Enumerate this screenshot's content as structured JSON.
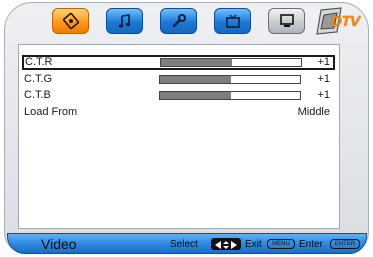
{
  "tabs": [
    {
      "id": "picture",
      "icon": "picture-icon",
      "active": true
    },
    {
      "id": "audio",
      "icon": "music-note-icon",
      "active": false
    },
    {
      "id": "setup",
      "icon": "wrench-icon",
      "active": false
    },
    {
      "id": "tv",
      "icon": "tv-icon",
      "active": false
    },
    {
      "id": "pc",
      "icon": "monitor-icon",
      "active": false
    },
    {
      "id": "dtv",
      "icon": "dtv-logo-icon",
      "label": "DTV"
    }
  ],
  "settings": [
    {
      "label": "C.T.R",
      "value": "+1",
      "level": 0.51,
      "selected": true
    },
    {
      "label": "C.T.G",
      "value": "+1",
      "level": 0.51
    },
    {
      "label": "C.T.B",
      "value": "+1",
      "level": 0.51
    },
    {
      "label": "Load From",
      "value": "Middle"
    }
  ],
  "footer": {
    "title": "Video",
    "select_label": "Select",
    "exit_label": "Exit",
    "exit_key": "MENU",
    "enter_label": "Enter",
    "enter_key": "ENTER"
  },
  "colors": {
    "tab_blue": "#1c79d6",
    "tab_active": "#ff9a1e",
    "slider_fill": "#7e7e7e",
    "footer_blue": "#2c86dd"
  }
}
